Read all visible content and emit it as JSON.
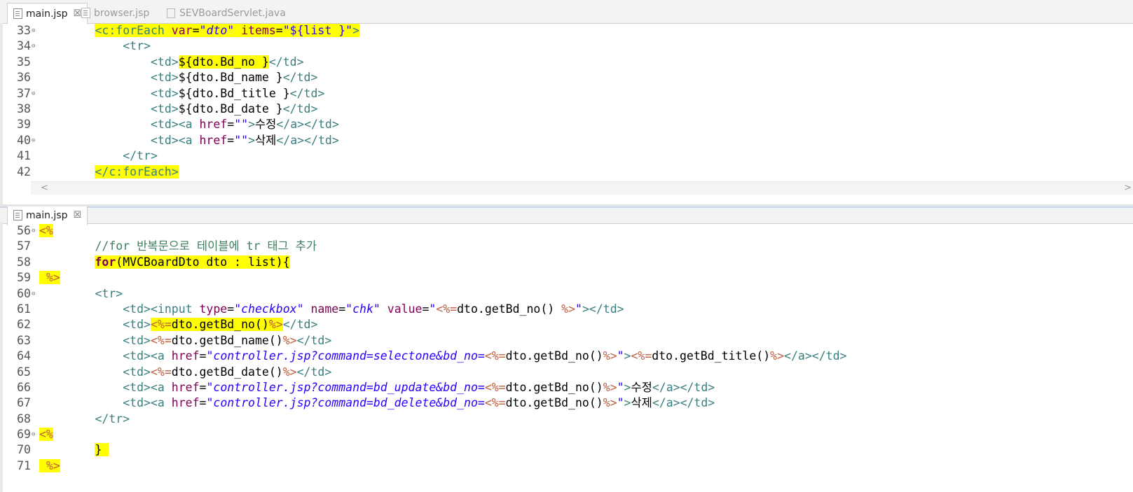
{
  "top_pane": {
    "tabs": [
      {
        "label": "main.jsp",
        "active": true,
        "close": "☒"
      },
      {
        "label": "browser.jsp",
        "active": false
      },
      {
        "label": "SEVBoardServlet.java",
        "active": false
      }
    ],
    "lines": [
      {
        "no": "33",
        "fold": "⊖",
        "code": "        <c:forEach var=\"dto\" items=\"${list }\">"
      },
      {
        "no": "34",
        "fold": "⊖",
        "code": "            <tr>"
      },
      {
        "no": "35",
        "fold": "",
        "code": "                <td>${dto.Bd_no }</td>"
      },
      {
        "no": "36",
        "fold": "",
        "code": "                <td>${dto.Bd_name }</td>"
      },
      {
        "no": "37",
        "fold": "⊖",
        "code": "                <td>${dto.Bd_title }</td>"
      },
      {
        "no": "38",
        "fold": "",
        "code": "                <td>${dto.Bd_date }</td>"
      },
      {
        "no": "39",
        "fold": "",
        "code": "                <td><a href=\"\">수정</a></td>"
      },
      {
        "no": "40",
        "fold": "⊖",
        "code": "                <td><a href=\"\">삭제</a></td>"
      },
      {
        "no": "41",
        "fold": "",
        "code": "            </tr>"
      },
      {
        "no": "42",
        "fold": "",
        "code": "        </c:forEach>"
      }
    ]
  },
  "bottom_pane": {
    "tabs": [
      {
        "label": "main.jsp",
        "active": true,
        "close": "☒"
      }
    ],
    "lines": [
      {
        "no": "56",
        "fold": "⊖",
        "code": "<%"
      },
      {
        "no": "57",
        "fold": "",
        "code": "        //for 반복문으로 테이블에 tr 태그 추가"
      },
      {
        "no": "58",
        "fold": "",
        "code": "        for(MVCBoardDto dto : list){"
      },
      {
        "no": "59",
        "fold": "",
        "code": " %>"
      },
      {
        "no": "60",
        "fold": "⊖",
        "code": "        <tr>"
      },
      {
        "no": "61",
        "fold": "",
        "code": "            <td><input type=\"checkbox\" name=\"chk\" value=\"<%=dto.getBd_no() %>\"></td>"
      },
      {
        "no": "62",
        "fold": "",
        "code": "            <td><%=dto.getBd_no()%></td>"
      },
      {
        "no": "63",
        "fold": "",
        "code": "            <td><%=dto.getBd_name()%></td>"
      },
      {
        "no": "64",
        "fold": "",
        "code": "            <td><a href=\"controller.jsp?command=selectone&bd_no=<%=dto.getBd_no()%>\"><%=dto.getBd_title()%></a></td>"
      },
      {
        "no": "65",
        "fold": "",
        "code": "            <td><%=dto.getBd_date()%></td>"
      },
      {
        "no": "66",
        "fold": "",
        "code": "            <td><a href=\"controller.jsp?command=bd_update&bd_no=<%=dto.getBd_no()%>\">수정</a></td>"
      },
      {
        "no": "67",
        "fold": "",
        "code": "            <td><a href=\"controller.jsp?command=bd_delete&bd_no=<%=dto.getBd_no()%>\">삭제</a></td>"
      },
      {
        "no": "68",
        "fold": "",
        "code": "        </tr>"
      },
      {
        "no": "69",
        "fold": "⊖",
        "code": "<%"
      },
      {
        "no": "70",
        "fold": "",
        "code": "        }"
      },
      {
        "no": "71",
        "fold": "",
        "code": " %>"
      }
    ]
  },
  "scrollbar": {
    "left_arrow": "<",
    "right_arrow": ">"
  },
  "colors": {
    "highlight": "#ffff00",
    "tag": "#3a7f7f",
    "attribute": "#7f0055",
    "string": "#2a00ff",
    "jsp_delimiter": "#bf5f3f",
    "comment": "#3f7f5f"
  }
}
